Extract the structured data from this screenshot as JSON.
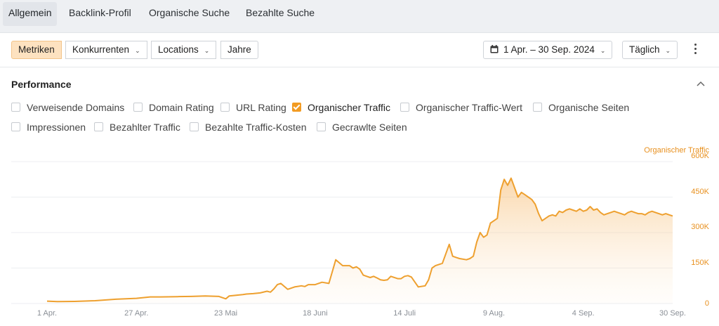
{
  "tabs": [
    {
      "label": "Allgemein",
      "active": true
    },
    {
      "label": "Backlink-Profil",
      "active": false
    },
    {
      "label": "Organische Suche",
      "active": false
    },
    {
      "label": "Bezahlte Suche",
      "active": false
    }
  ],
  "toolbar": {
    "metriken": "Metriken",
    "konkurrenten": "Konkurrenten",
    "locations": "Locations",
    "jahre": "Jahre",
    "date_range": "1 Apr. – 30 Sep. 2024",
    "interval": "Täglich",
    "chevron_icon": "chevron-down-icon",
    "calendar_icon": "calendar-icon",
    "more_icon": "more-vertical-icon"
  },
  "performance": {
    "title": "Performance",
    "metrics": [
      {
        "label": "Verweisende Domains",
        "checked": false
      },
      {
        "label": "Domain Rating",
        "checked": false
      },
      {
        "label": "URL Rating",
        "checked": false
      },
      {
        "label": "Organischer Traffic",
        "checked": true
      },
      {
        "label": "Organischer Traffic-Wert",
        "checked": false
      },
      {
        "label": "Organische Seiten",
        "checked": false
      },
      {
        "label": "Impressionen",
        "checked": false
      },
      {
        "label": "Bezahlter Traffic",
        "checked": false
      },
      {
        "label": "Bezahlte Traffic-Kosten",
        "checked": false
      },
      {
        "label": "Gecrawlte Seiten",
        "checked": false
      }
    ]
  },
  "colors": {
    "accent": "#f29b22",
    "series_line": "#eea02f",
    "axis_text": "#e8901e",
    "grid": "#eceef1"
  },
  "chart_data": {
    "type": "area",
    "legend": "Organischer Traffic",
    "legend_placement": "top-right",
    "grid": true,
    "y_ticks": [
      "0",
      "150K",
      "300K",
      "450K",
      "600K"
    ],
    "y_tick_values": [
      0,
      150000,
      300000,
      450000,
      600000
    ],
    "ylim": [
      0,
      600000
    ],
    "x_ticks": [
      "1 Apr.",
      "27 Apr.",
      "23 Mai",
      "18 Juni",
      "14 Juli",
      "9 Aug.",
      "4 Sep.",
      "30 Sep."
    ],
    "x_tick_days": [
      0,
      26,
      52,
      78,
      104,
      130,
      156,
      182
    ],
    "xlim_days": [
      0,
      182
    ],
    "series": [
      {
        "name": "Organischer Traffic",
        "x_days": [
          0,
          3,
          8,
          14,
          20,
          26,
          30,
          33,
          38,
          42,
          46,
          50,
          52,
          53,
          55,
          57,
          58,
          60,
          62,
          64,
          65,
          66,
          67,
          68,
          70,
          72,
          74,
          75,
          76,
          78,
          80,
          82,
          84,
          86,
          88,
          89,
          90,
          91,
          92,
          93,
          94,
          95,
          96,
          97,
          98,
          99,
          100,
          102,
          103,
          104,
          105,
          106,
          108,
          110,
          111,
          112,
          113,
          115,
          117,
          118,
          119,
          120,
          122,
          123,
          124,
          125,
          126,
          127,
          128,
          129,
          130,
          131,
          132,
          133,
          134,
          135,
          136,
          137,
          138,
          139,
          140,
          141,
          142,
          143,
          144,
          145,
          146,
          147,
          148,
          149,
          150,
          151,
          152,
          153,
          154,
          155,
          156,
          157,
          158,
          159,
          160,
          161,
          162,
          163,
          164,
          165,
          166,
          167,
          168,
          169,
          170,
          171,
          172,
          173,
          174,
          175,
          176,
          177,
          178,
          179,
          180,
          181,
          182
        ],
        "values": [
          10000,
          8000,
          9000,
          12000,
          18000,
          22000,
          28000,
          28000,
          29000,
          30000,
          32000,
          30000,
          20000,
          32000,
          35000,
          38000,
          40000,
          42000,
          45000,
          52000,
          48000,
          62000,
          80000,
          85000,
          60000,
          70000,
          75000,
          72000,
          80000,
          80000,
          90000,
          85000,
          185000,
          160000,
          160000,
          150000,
          155000,
          145000,
          120000,
          115000,
          110000,
          115000,
          108000,
          100000,
          98000,
          100000,
          115000,
          105000,
          105000,
          115000,
          118000,
          112000,
          70000,
          75000,
          100000,
          150000,
          160000,
          170000,
          250000,
          200000,
          195000,
          190000,
          185000,
          190000,
          200000,
          260000,
          300000,
          280000,
          290000,
          340000,
          350000,
          360000,
          480000,
          525000,
          500000,
          530000,
          490000,
          450000,
          470000,
          460000,
          450000,
          440000,
          420000,
          380000,
          350000,
          360000,
          370000,
          375000,
          370000,
          390000,
          385000,
          395000,
          400000,
          395000,
          390000,
          400000,
          390000,
          395000,
          410000,
          395000,
          400000,
          385000,
          375000,
          380000,
          385000,
          390000,
          385000,
          380000,
          375000,
          385000,
          390000,
          385000,
          380000,
          380000,
          375000,
          385000,
          390000,
          385000,
          380000,
          375000,
          380000,
          375000,
          370000
        ]
      }
    ]
  }
}
